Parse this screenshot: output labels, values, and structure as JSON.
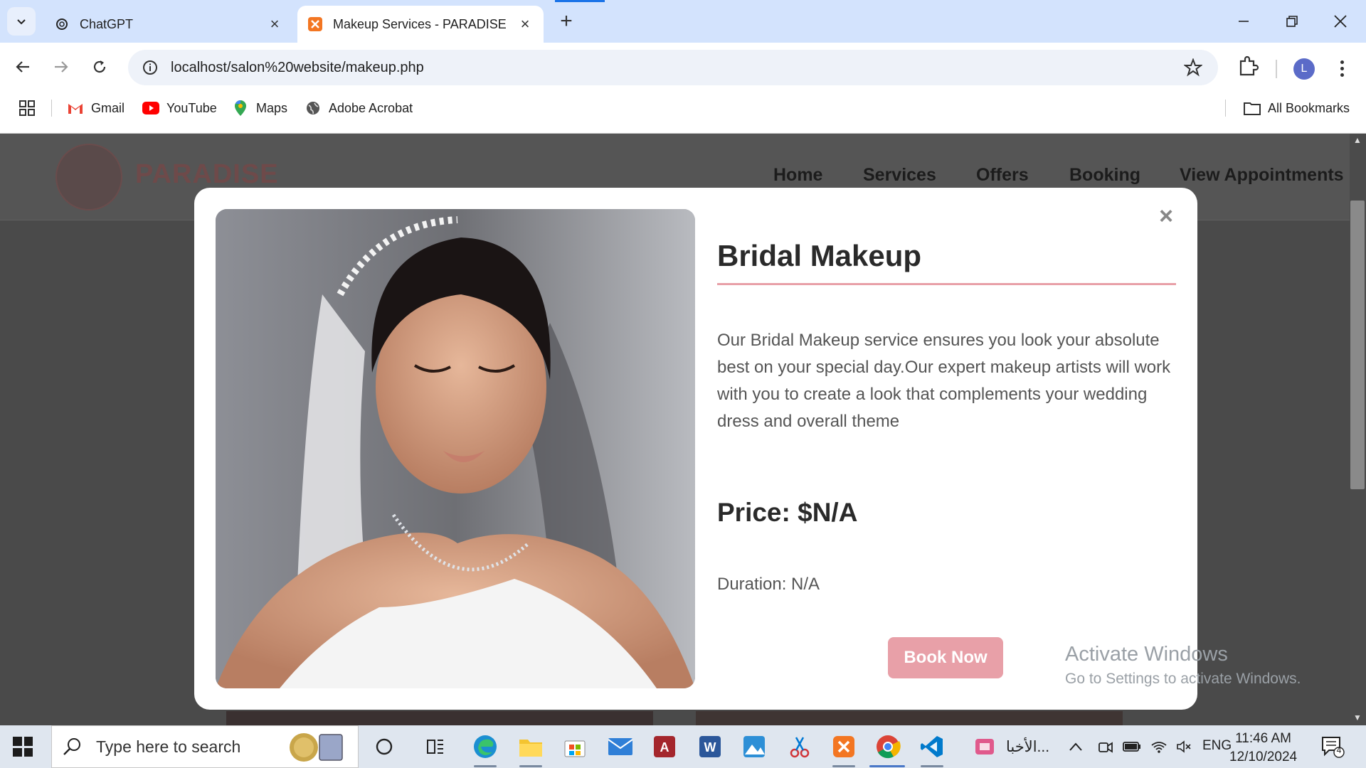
{
  "browser": {
    "tabs": [
      {
        "title": "ChatGPT",
        "active": false
      },
      {
        "title": "Makeup Services - PARADISE",
        "active": true
      }
    ],
    "url": "localhost/salon%20website/makeup.php",
    "profile_initial": "L",
    "bookmarks": [
      {
        "label": "Gmail",
        "icon": "gmail-icon"
      },
      {
        "label": "YouTube",
        "icon": "youtube-icon"
      },
      {
        "label": "Maps",
        "icon": "maps-icon"
      },
      {
        "label": "Adobe Acrobat",
        "icon": "globe-icon"
      }
    ],
    "all_bookmarks_label": "All Bookmarks"
  },
  "site": {
    "logo_text": "PARADISE",
    "nav": [
      "Home",
      "Services",
      "Offers",
      "Booking",
      "View Appointments"
    ]
  },
  "modal": {
    "title": "Bridal Makeup",
    "description": "Our Bridal Makeup service ensures you look your absolute best on your special day.Our expert makeup artists will work with you to create a look that complements your wedding dress and overall theme",
    "price": "Price: $N/A",
    "duration": "Duration: N/A",
    "book_button": "Book Now",
    "close_symbol": "×",
    "accent_color": "#e8a0a8"
  },
  "watermark": {
    "line1": "Activate Windows",
    "line2": "Go to Settings to activate Windows."
  },
  "taskbar": {
    "search_placeholder": "Type here to search",
    "arabic_label": "الأخبا...",
    "language": "ENG",
    "time": "11:46 AM",
    "date": "12/10/2024",
    "notification_count": "4"
  }
}
